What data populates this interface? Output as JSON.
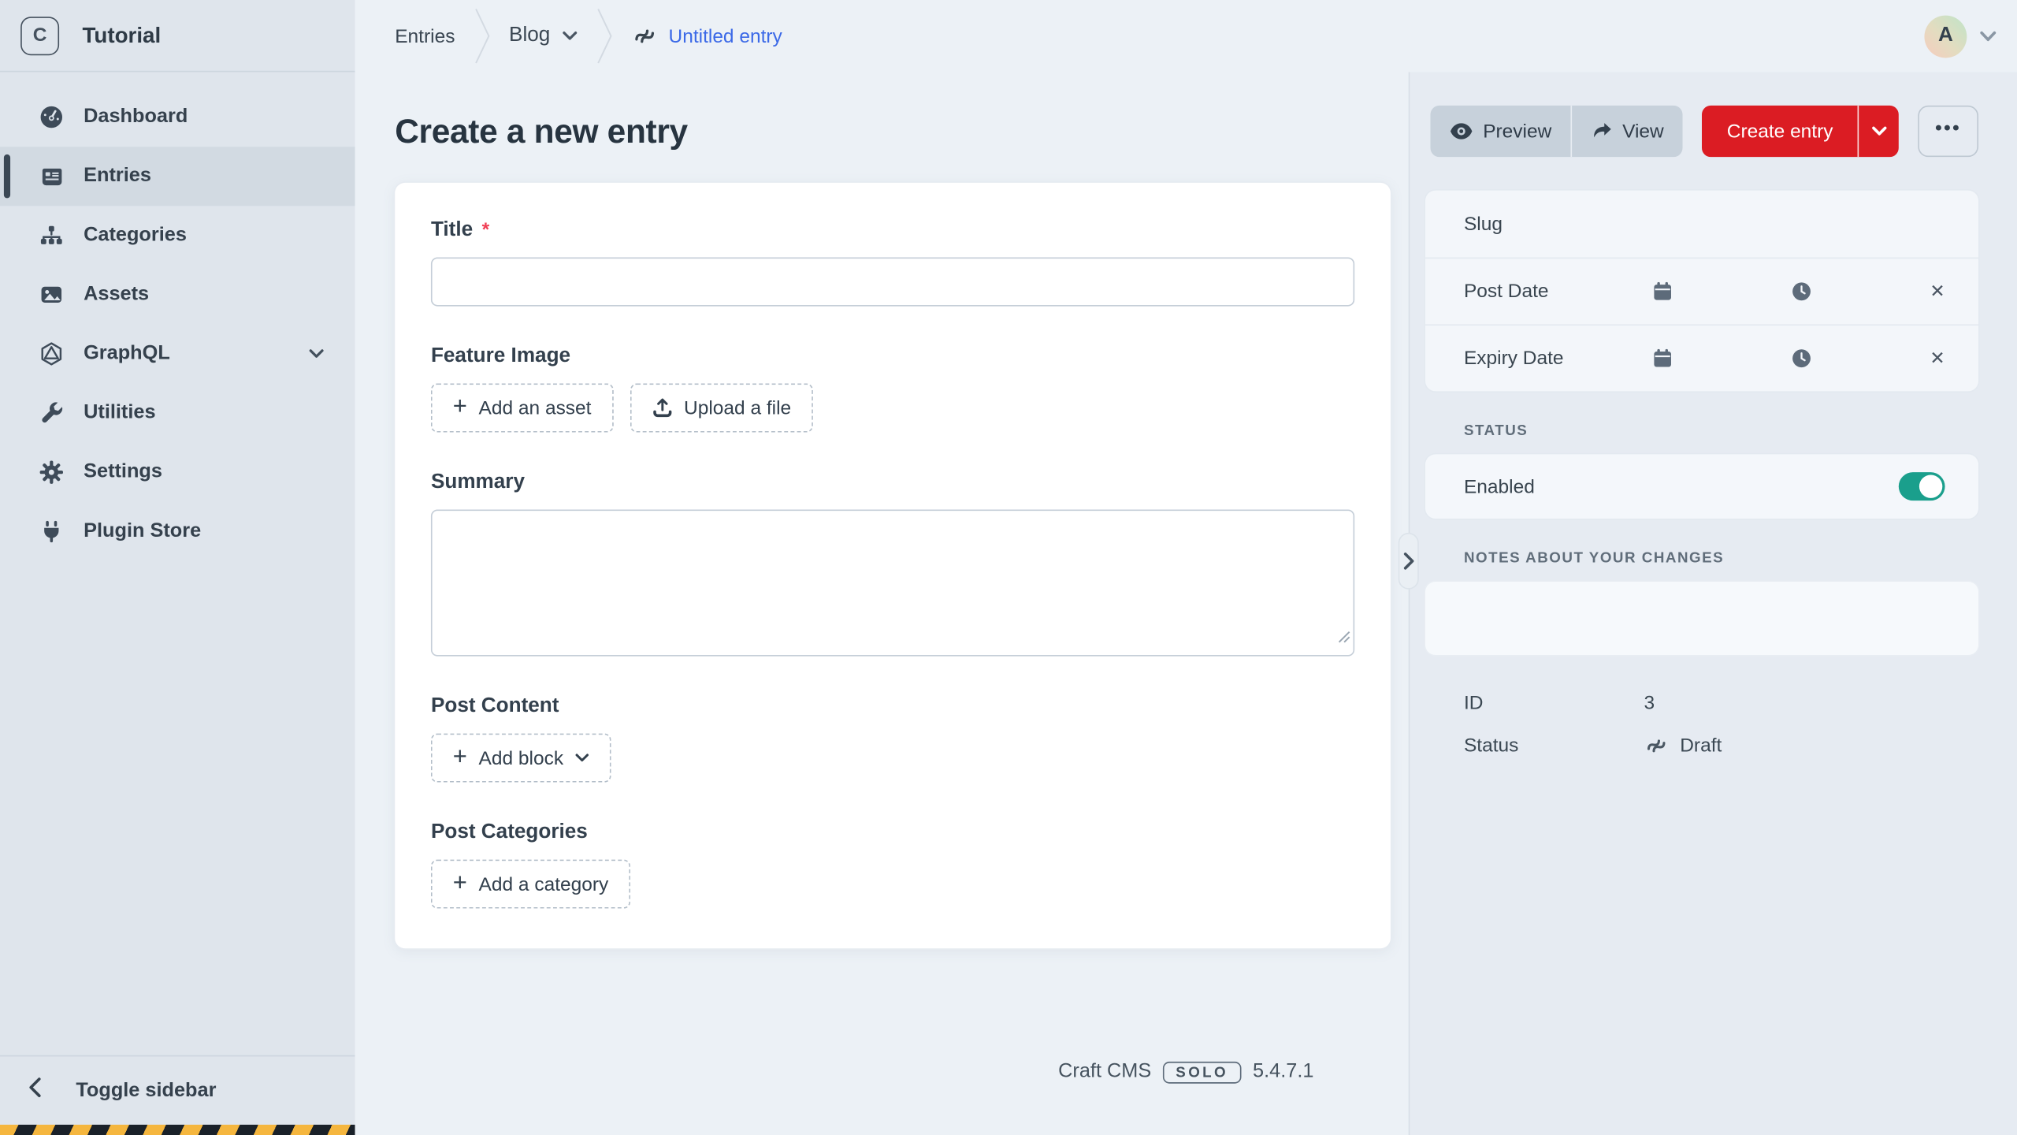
{
  "brand": {
    "logo_letter": "C",
    "site_name": "Tutorial"
  },
  "sidebar": {
    "items": [
      {
        "label": "Dashboard",
        "icon": "gauge-icon"
      },
      {
        "label": "Entries",
        "icon": "newspaper-icon"
      },
      {
        "label": "Categories",
        "icon": "sitemap-icon"
      },
      {
        "label": "Assets",
        "icon": "image-icon"
      },
      {
        "label": "GraphQL",
        "icon": "graphql-icon"
      },
      {
        "label": "Utilities",
        "icon": "wrench-icon"
      },
      {
        "label": "Settings",
        "icon": "gear-icon"
      },
      {
        "label": "Plugin Store",
        "icon": "plug-icon"
      }
    ],
    "active_item": "Entries",
    "toggle_label": "Toggle sidebar"
  },
  "topbar": {
    "breadcrumb_entries": "Entries",
    "breadcrumb_section": "Blog",
    "current_entry": "Untitled entry",
    "avatar_initial": "A"
  },
  "page": {
    "title": "Create a new entry"
  },
  "actions": {
    "preview": "Preview",
    "view": "View",
    "create": "Create entry",
    "more_label": "•••"
  },
  "form": {
    "title_label": "Title",
    "required_marker": "*",
    "title_value": "",
    "feature_image_label": "Feature Image",
    "add_asset_label": "Add an asset",
    "upload_label": "Upload a file",
    "summary_label": "Summary",
    "summary_value": "",
    "post_content_label": "Post Content",
    "add_block_label": "Add block",
    "post_categories_label": "Post Categories",
    "add_category_label": "Add a category"
  },
  "details": {
    "slug_label": "Slug",
    "post_date_label": "Post Date",
    "expiry_date_label": "Expiry Date",
    "status_heading": "STATUS",
    "enabled_label": "Enabled",
    "enabled_state": "on",
    "notes_heading": "NOTES ABOUT YOUR CHANGES",
    "notes_value": "",
    "id_label": "ID",
    "id_value": "3",
    "status_label": "Status",
    "status_value": "Draft"
  },
  "footer": {
    "product": "Craft CMS",
    "edition": "SOLO",
    "version": "5.4.7.1"
  },
  "colors": {
    "accent_red": "#DB1C23",
    "link_blue": "#3B69E7",
    "toggle_teal": "#1A9F8C",
    "sidebar_bg": "#DFE5EC",
    "hazard_yellow": "#F5B63E"
  }
}
